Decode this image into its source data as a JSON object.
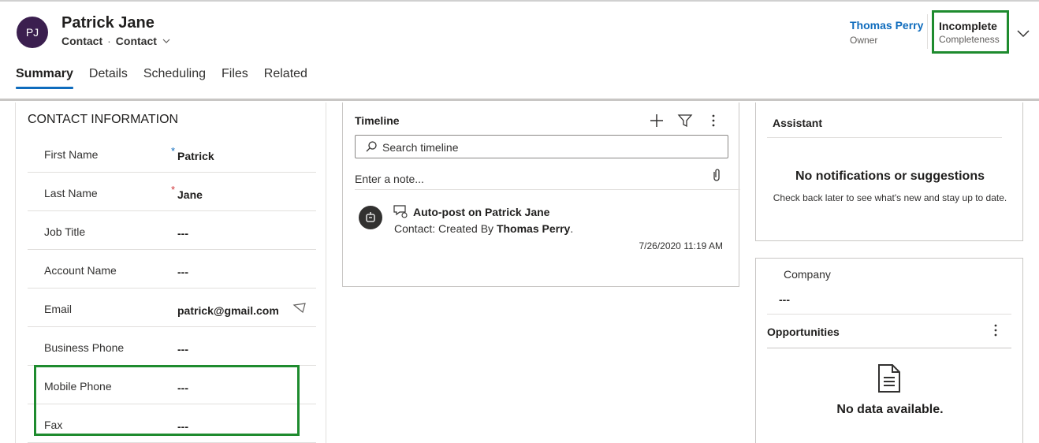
{
  "record": {
    "initials": "PJ",
    "name": "Patrick Jane",
    "entity": "Contact",
    "separator": "·",
    "form_selector": "Contact",
    "avatar_color": "#3b1f4f"
  },
  "header_fields": {
    "owner_name": "Thomas Perry",
    "owner_label": "Owner",
    "completeness_value": "Incomplete",
    "completeness_label": "Completeness"
  },
  "tabs": [
    {
      "label": "Summary",
      "active": true
    },
    {
      "label": "Details",
      "active": false
    },
    {
      "label": "Scheduling",
      "active": false
    },
    {
      "label": "Files",
      "active": false
    },
    {
      "label": "Related",
      "active": false
    }
  ],
  "contact_info": {
    "title": "CONTACT INFORMATION",
    "fields": [
      {
        "label": "First Name",
        "value": "Patrick",
        "required": "*",
        "required_color": "#0f6cbd"
      },
      {
        "label": "Last Name",
        "value": "Jane",
        "required": "*",
        "required_color": "#d13438"
      },
      {
        "label": "Job Title",
        "value": "---"
      },
      {
        "label": "Account Name",
        "value": "---"
      },
      {
        "label": "Email",
        "value": "patrick@gmail.com",
        "action_icon": "send-email-icon"
      },
      {
        "label": "Business Phone",
        "value": "---"
      },
      {
        "label": "Mobile Phone",
        "value": "---"
      },
      {
        "label": "Fax",
        "value": "---"
      }
    ]
  },
  "timeline": {
    "title": "Timeline",
    "search_placeholder": "Search timeline",
    "note_placeholder": "Enter a note...",
    "post": {
      "title": "Auto-post on Patrick Jane",
      "body_prefix": "Contact: Created By ",
      "body_author": "Thomas Perry",
      "body_suffix": ".",
      "timestamp": "7/26/2020 11:19 AM"
    }
  },
  "assistant": {
    "title": "Assistant",
    "heading": "No notifications or suggestions",
    "message": "Check back later to see what's new and stay up to date."
  },
  "company": {
    "label": "Company",
    "value": "---"
  },
  "opportunities": {
    "title": "Opportunities",
    "empty_text": "No data available."
  },
  "colors": {
    "accent": "#0f6cbd",
    "highlight": "#1e8b2e"
  }
}
